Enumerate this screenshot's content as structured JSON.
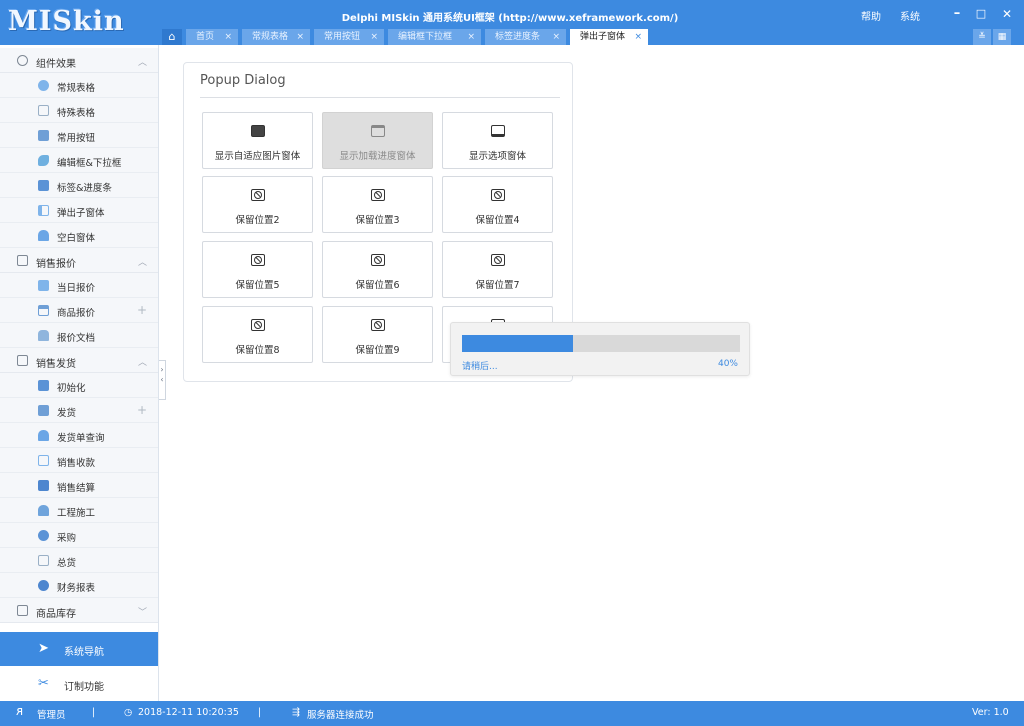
{
  "app": {
    "logo": "MISkin",
    "title": "Delphi MISkin 通用系统UI框架 (http://www.xeframework.com/)",
    "menu_help": "帮助",
    "menu_system": "系统",
    "minimize": "–",
    "maximize": "□",
    "close": "✕"
  },
  "tabs": {
    "home_icon": "home-icon",
    "close_glyph": "×",
    "items": [
      {
        "label": "首页",
        "active": false
      },
      {
        "label": "常规表格",
        "active": false
      },
      {
        "label": "常用按钮",
        "active": false
      },
      {
        "label": "编辑框下拉框",
        "active": false
      },
      {
        "label": "标签进度条",
        "active": false
      },
      {
        "label": "弹出子窗体",
        "active": true
      }
    ],
    "chevron_icon": "double-chevron-down-icon",
    "grid_icon": "grid-icon"
  },
  "sidebar": {
    "groups": [
      {
        "label": "组件效果",
        "icon": "gear-icon",
        "expanded": true,
        "items": [
          {
            "label": "常规表格",
            "icon": "table-icon",
            "color": "#7fb4ea",
            "plus": ""
          },
          {
            "label": "特殊表格",
            "icon": "doc-icon",
            "color": "#9ab0c6",
            "plus": ""
          },
          {
            "label": "常用按钮",
            "icon": "button-icon",
            "color": "#6f9fd6",
            "plus": ""
          },
          {
            "label": "编辑框&下拉框",
            "icon": "edit-icon",
            "color": "#6fb0e0",
            "plus": ""
          },
          {
            "label": "标签&进度条",
            "icon": "tag-icon",
            "color": "#5b93d6",
            "plus": ""
          },
          {
            "label": "弹出子窗体",
            "icon": "popup-icon",
            "color": "#7fb4ea",
            "plus": ""
          },
          {
            "label": "空白窗体",
            "icon": "house-icon",
            "color": "#6ba6e6",
            "plus": ""
          }
        ]
      },
      {
        "label": "销售报价",
        "icon": "calculator-icon",
        "expanded": true,
        "items": [
          {
            "label": "当日报价",
            "icon": "calendar-icon",
            "color": "#7fb4ea",
            "plus": ""
          },
          {
            "label": "商品报价",
            "icon": "price-icon",
            "color": "#6f9fd6",
            "plus": "+"
          },
          {
            "label": "报价文档",
            "icon": "folder-icon",
            "color": "#8fb5dd",
            "plus": ""
          }
        ]
      },
      {
        "label": "销售发货",
        "icon": "truck-icon",
        "expanded": true,
        "items": [
          {
            "label": "初始化",
            "icon": "chart-icon",
            "color": "#5b93d6",
            "plus": ""
          },
          {
            "label": "发货",
            "icon": "ship-icon",
            "color": "#6f9fd6",
            "plus": "+"
          },
          {
            "label": "发货单查询",
            "icon": "house-icon",
            "color": "#6ba6e6",
            "plus": ""
          },
          {
            "label": "销售收款",
            "icon": "receipt-icon",
            "color": "#7fb4ea",
            "plus": ""
          },
          {
            "label": "销售结算",
            "icon": "invoice-icon",
            "color": "#4d86cf",
            "plus": ""
          },
          {
            "label": "工程施工",
            "icon": "construction-icon",
            "color": "#6fa4dc",
            "plus": ""
          },
          {
            "label": "采购",
            "icon": "people-icon",
            "color": "#5b93d6",
            "plus": ""
          },
          {
            "label": "总货",
            "icon": "box-icon",
            "color": "#9ab0c6",
            "plus": ""
          },
          {
            "label": "财务报表",
            "icon": "report-icon",
            "color": "#4d86cf",
            "plus": ""
          }
        ]
      },
      {
        "label": "商品库存",
        "icon": "inventory-icon",
        "expanded": false,
        "items": []
      }
    ],
    "nav_button": {
      "label": "系统导航",
      "icon": "send-icon"
    },
    "custom_button": {
      "label": "订制功能",
      "icon": "tools-icon"
    },
    "chevron_up": "︿",
    "chevron_down": "﹀",
    "collapse_glyph_right": "›",
    "collapse_glyph_left": "‹"
  },
  "panel": {
    "title": "Popup Dialog",
    "buttons": [
      {
        "label": "显示自适应图片窗体",
        "icon": "image-icon",
        "disabled": false
      },
      {
        "label": "显示加载进度窗体",
        "icon": "window-icon",
        "disabled": true
      },
      {
        "label": "显示选项窗体",
        "icon": "monitor-icon",
        "disabled": false
      },
      {
        "label": "保留位置2",
        "icon": "ban-icon",
        "disabled": false
      },
      {
        "label": "保留位置3",
        "icon": "ban-icon",
        "disabled": false
      },
      {
        "label": "保留位置4",
        "icon": "ban-icon",
        "disabled": false
      },
      {
        "label": "保留位置5",
        "icon": "ban-icon",
        "disabled": false
      },
      {
        "label": "保留位置6",
        "icon": "ban-icon",
        "disabled": false
      },
      {
        "label": "保留位置7",
        "icon": "ban-icon",
        "disabled": false
      },
      {
        "label": "保留位置8",
        "icon": "ban-icon",
        "disabled": false
      },
      {
        "label": "保留位置9",
        "icon": "ban-icon",
        "disabled": false
      },
      {
        "label": "",
        "icon": "monitor-icon",
        "disabled": false
      }
    ]
  },
  "progress": {
    "message": "请稍后...",
    "percent_label": "40%",
    "value": 0.4
  },
  "status": {
    "user_icon": "user-icon",
    "user": "管理员",
    "sep": "|",
    "clock_icon": "clock-icon",
    "datetime": "2018-12-11 10:20:35",
    "server_icon": "server-icon",
    "server": "服务器连接成功",
    "version": "Ver: 1.0"
  },
  "colors": {
    "accent": "#3d8ae0",
    "tab_inactive": "#6aa6ea",
    "progress_track": "#d9d9d9",
    "disabled_button": "#dedede"
  }
}
